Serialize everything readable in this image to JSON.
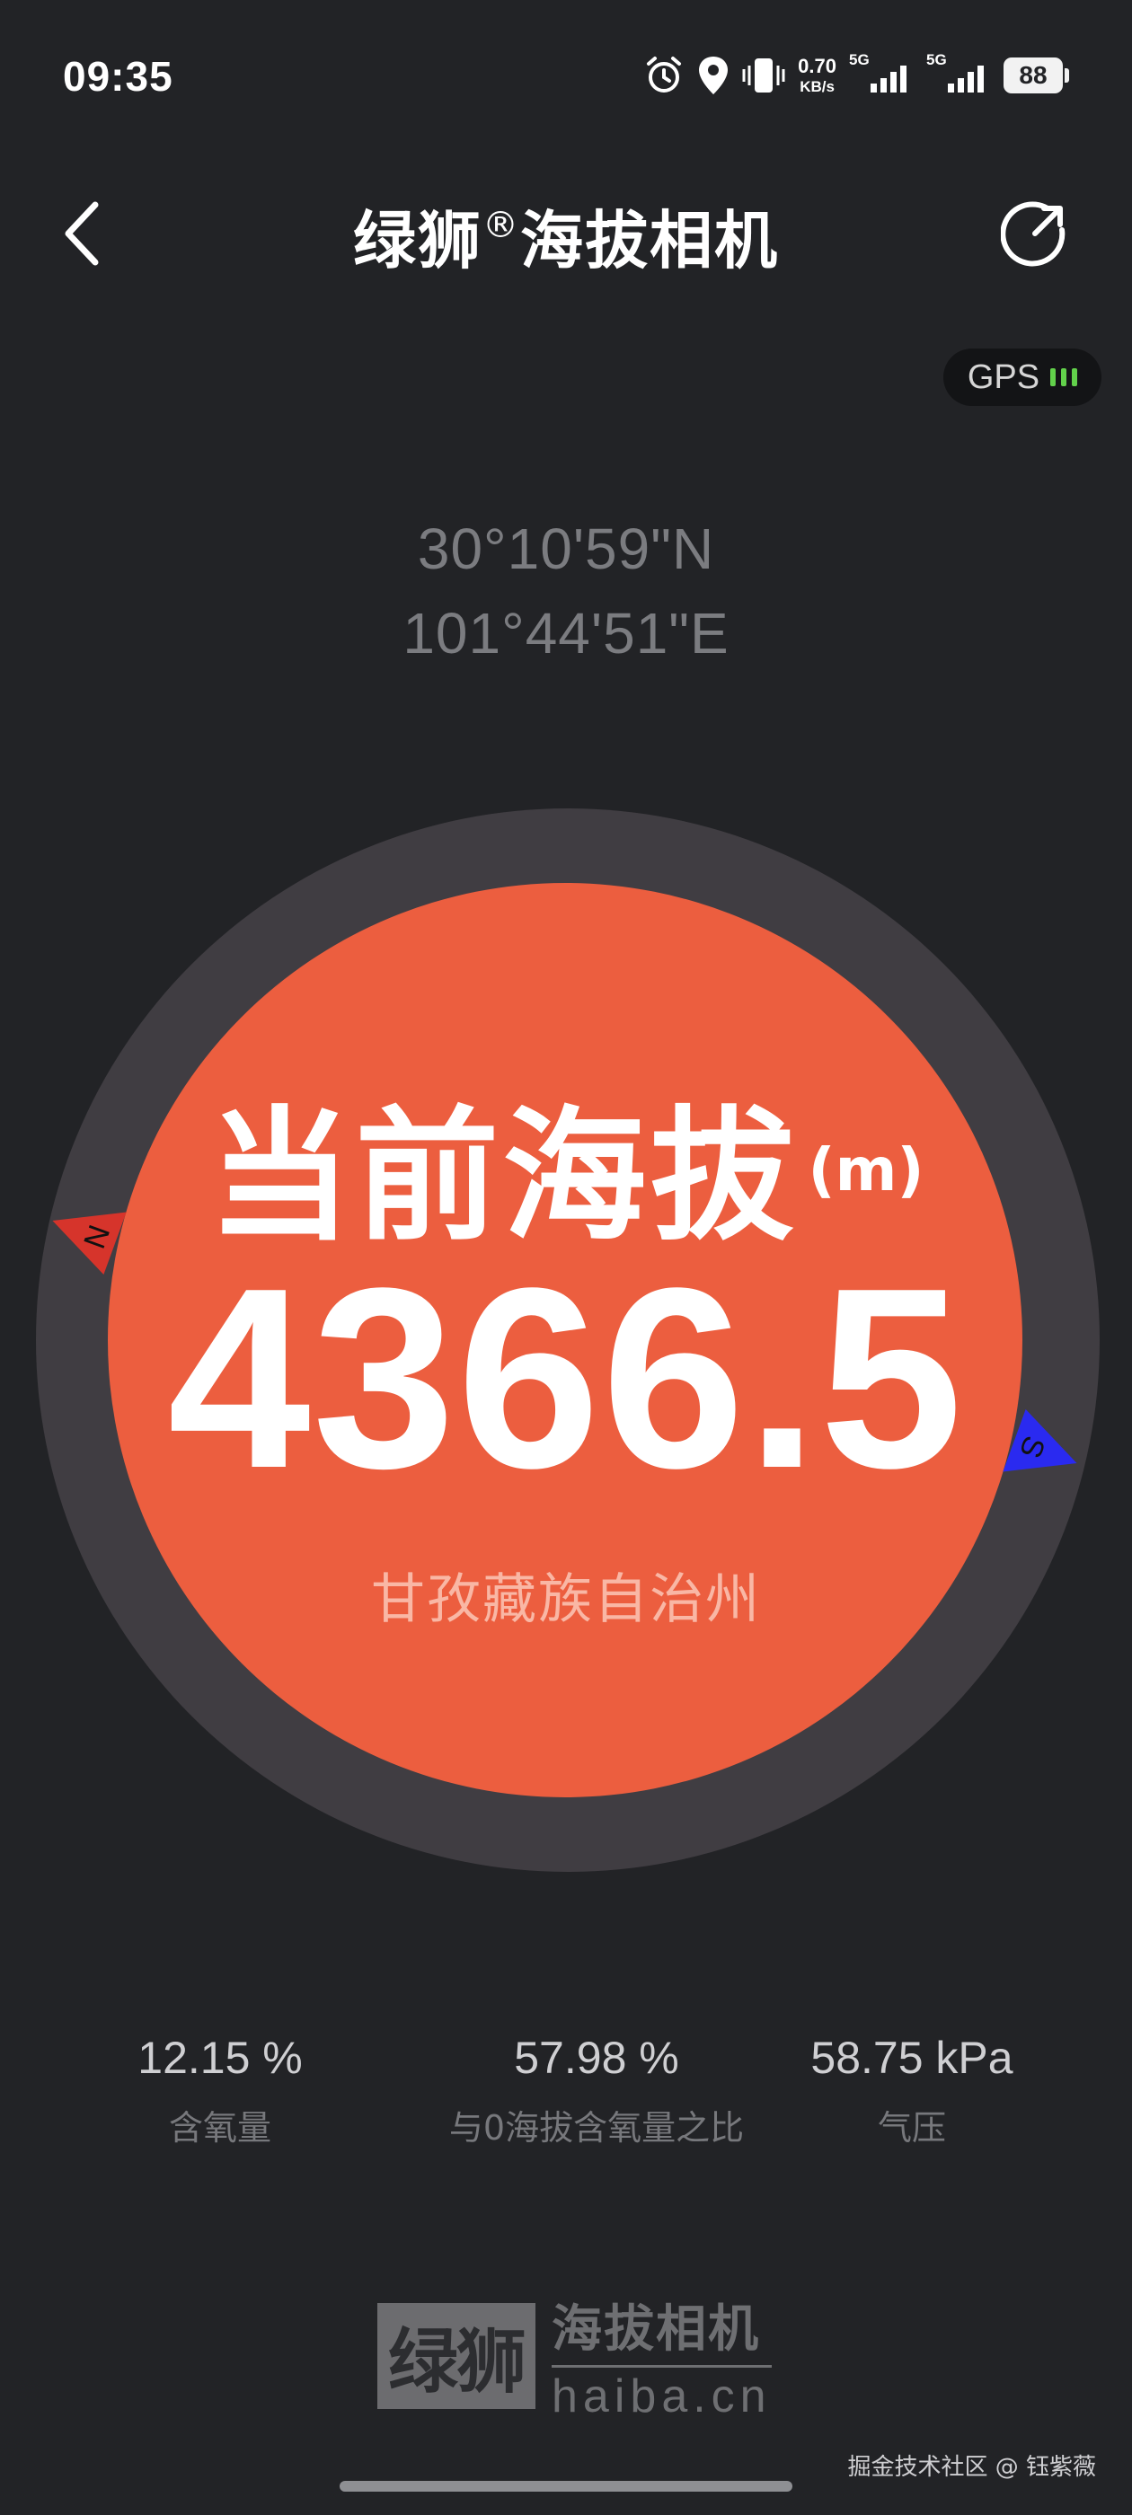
{
  "status_bar": {
    "time": "09:35",
    "net_speed_value": "0.70",
    "net_speed_unit": "KB/s",
    "signal_1_tag": "5G",
    "signal_2_tag": "5G",
    "battery": "88",
    "icons": [
      "alarm-icon",
      "location-icon",
      "vibrate-icon",
      "signal-icon",
      "battery-icon"
    ]
  },
  "header": {
    "title_brand": "绿狮",
    "title_reg": "®",
    "title_rest": "海拔相机",
    "back_icon": "chevron-left-icon",
    "share_icon": "share-icon"
  },
  "gps": {
    "label": "GPS",
    "signal_bars": 3,
    "signal_color": "#62d14b"
  },
  "coordinates": {
    "latitude": "30°10'59\"N",
    "longitude": "101°44'51\"E"
  },
  "altitude": {
    "label": "当前海拔",
    "unit": "(m)",
    "value": "4366.5",
    "region": "甘孜藏族自治州"
  },
  "compass": {
    "north_label": "N",
    "south_label": "S",
    "north_color": "#d6342b",
    "south_color": "#2a2af0"
  },
  "stats": [
    {
      "value": "12.15 %",
      "label": "含氧量"
    },
    {
      "value": "57.98 %",
      "label": "与0海拔含氧量之比"
    },
    {
      "value": "58.75 kPa",
      "label": "气压"
    }
  ],
  "footer": {
    "logo_box": "绿狮",
    "logo_name": "海拔相机",
    "logo_url": "haiba.cn",
    "watermark": "掘金技术社区 @ 钰紫薇"
  },
  "colors": {
    "background": "#222326",
    "dial_ring": "#403d42",
    "accent": "#ec5e3f"
  }
}
